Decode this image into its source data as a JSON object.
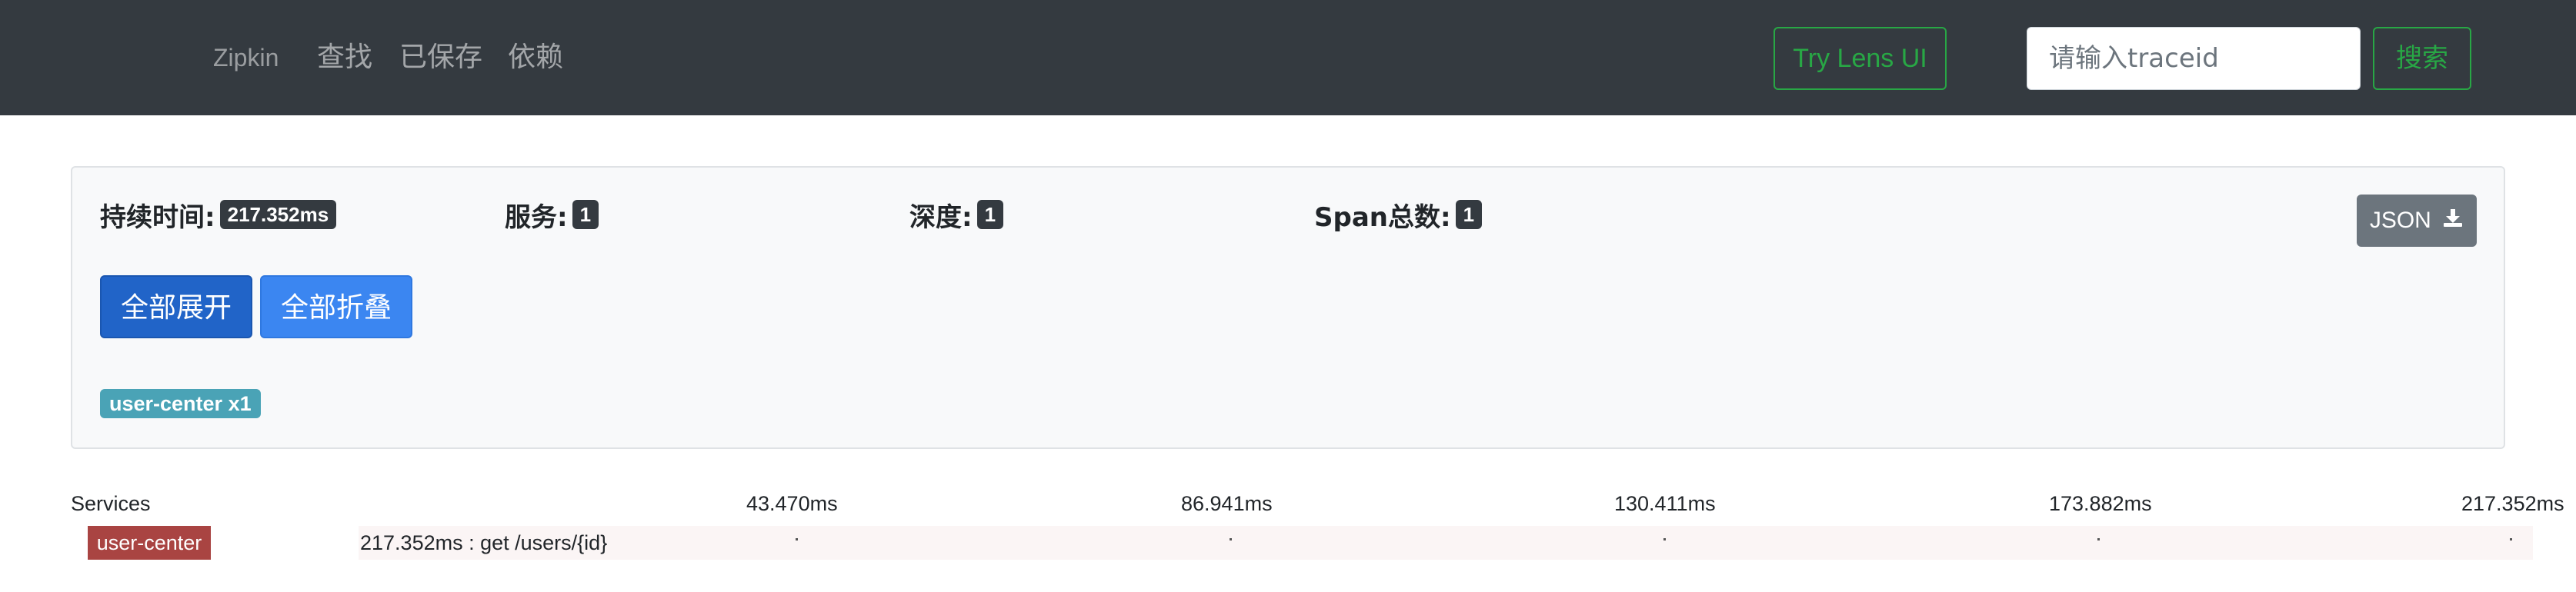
{
  "navbar": {
    "brand": "Zipkin",
    "links": [
      {
        "label": "查找"
      },
      {
        "label": "已保存"
      },
      {
        "label": "依赖"
      }
    ],
    "lens_button": "Try Lens UI",
    "search_placeholder": "请输入traceid",
    "search_button": "搜索",
    "accent_color": "#28a745",
    "background_color": "#343a40"
  },
  "summary": {
    "duration_label": "持续时间:",
    "duration_value": "217.352ms",
    "services_label": "服务:",
    "services_value": "1",
    "depth_label": "深度:",
    "depth_value": "1",
    "span_count_label": "Span总数:",
    "span_count_value": "1",
    "json_button": "JSON",
    "json_icon": "download-icon",
    "expand_all": "全部展开",
    "collapse_all": "全部折叠",
    "service_badge": "user-center x1"
  },
  "timeline": {
    "services_header": "Services",
    "ticks": [
      "43.470ms",
      "86.941ms",
      "130.411ms",
      "173.882ms",
      "217.352ms"
    ],
    "rows": [
      {
        "service": "user-center",
        "span_text": "217.352ms : get /users/{id}",
        "label_color": "#a94442"
      }
    ]
  }
}
